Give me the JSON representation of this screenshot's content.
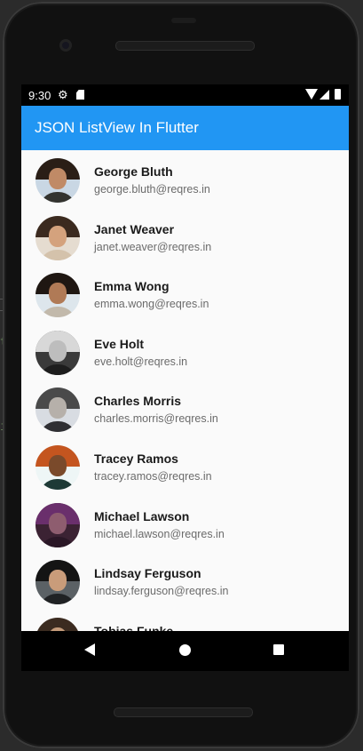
{
  "status_bar": {
    "time": "9:30",
    "icons": [
      "settings-icon",
      "sd-card-icon",
      "wifi-icon",
      "signal-icon",
      "battery-icon"
    ]
  },
  "app_bar": {
    "title": "JSON ListView In Flutter",
    "color": "#2196f3"
  },
  "users": [
    {
      "name": "George Bluth",
      "email": "george.bluth@reqres.in",
      "bg": "#c9d7e4",
      "hair": "#2a1e16",
      "skin": "#c08a66",
      "shirt": "#33332f"
    },
    {
      "name": "Janet Weaver",
      "email": "janet.weaver@reqres.in",
      "bg": "#e5dcd0",
      "hair": "#3b2a1f",
      "skin": "#d4a27d",
      "shirt": "#d4c2ab"
    },
    {
      "name": "Emma Wong",
      "email": "emma.wong@reqres.in",
      "bg": "#dde6ec",
      "hair": "#1f1712",
      "skin": "#b07a56",
      "shirt": "#c2b9ab"
    },
    {
      "name": "Eve Holt",
      "email": "eve.holt@reqres.in",
      "bg": "#3a3a3a",
      "hair": "#d8d8d8",
      "skin": "#bdbdbd",
      "shirt": "#1d1d1d"
    },
    {
      "name": "Charles Morris",
      "email": "charles.morris@reqres.in",
      "bg": "#d8dce2",
      "hair": "#4a4a4a",
      "skin": "#b6b0aa",
      "shirt": "#2f2f33"
    },
    {
      "name": "Tracey Ramos",
      "email": "tracey.ramos@reqres.in",
      "bg": "#eef6f6",
      "hair": "#c4551f",
      "skin": "#7a4a2b",
      "shirt": "#1e3a36"
    },
    {
      "name": "Michael Lawson",
      "email": "michael.lawson@reqres.in",
      "bg": "#3b2233",
      "hair": "#6a2f6c",
      "skin": "#8e5d6f",
      "shirt": "#2a1726"
    },
    {
      "name": "Lindsay Ferguson",
      "email": "lindsay.ferguson@reqres.in",
      "bg": "#5b6165",
      "hair": "#141414",
      "skin": "#c99c7a",
      "shirt": "#202224"
    },
    {
      "name": "Tobias Funke",
      "email": "",
      "bg": "#d5cfc6",
      "hair": "#3b2b20",
      "skin": "#c49b7a",
      "shirt": "#54514c"
    }
  ],
  "nav_bar": {
    "buttons": [
      "back-icon",
      "home-icon",
      "recents-icon"
    ]
  }
}
